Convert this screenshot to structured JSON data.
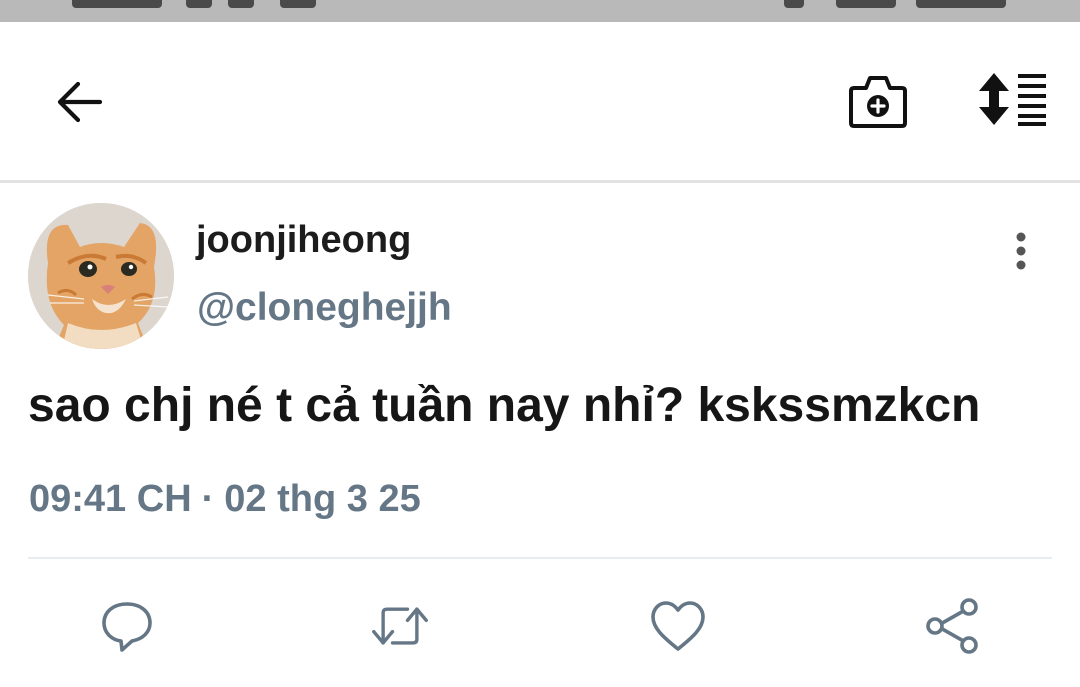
{
  "header": {
    "back_icon": "arrow-left-icon",
    "camera_icon": "camera-plus-icon",
    "sort_icon": "sort-list-icon"
  },
  "tweet": {
    "display_name": "joonjiheong",
    "handle": "@cloneghejjh",
    "text": "sao chj né t cả tuần nay nhỉ? kskssmzkcn",
    "time": "09:41 CH",
    "separator": "·",
    "date": "02 thg 3 25",
    "more_icon": "more-vertical-icon"
  },
  "actions": {
    "icons": [
      "reply-icon",
      "retweet-icon",
      "like-icon",
      "share-icon"
    ]
  },
  "colors": {
    "text": "#161616",
    "secondary": "#657786",
    "divider": "#e6ecf0",
    "status_bar": "#b9b9b9"
  }
}
